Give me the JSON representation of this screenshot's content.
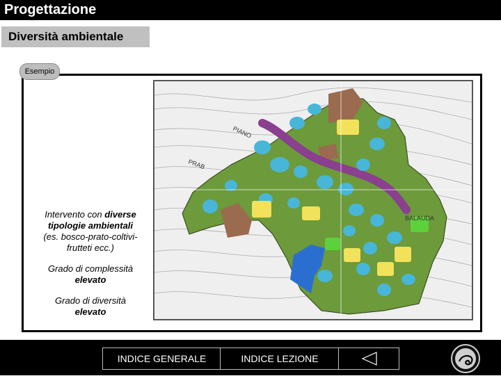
{
  "header": {
    "title": "Progettazione"
  },
  "section": {
    "subtitle": "Diversità ambientale"
  },
  "badge": {
    "label": "Esempio"
  },
  "description": {
    "p1_normal": "Intervento con ",
    "p1_bold1": "diverse",
    "p1_bold2": "tipologie ambientali",
    "p1_normal2": "(es. bosco-prato-coltivi-frutteti ecc.)",
    "p2_normal": "Grado di complessità",
    "p2_bold": "elevato",
    "p3_normal": "Grado di diversità",
    "p3_bold": "elevato"
  },
  "map": {
    "labels": [
      "PIANO",
      "PRAB",
      "BALAUDA"
    ],
    "colors": {
      "forest": "#6d9a3a",
      "meadow": "#48b6d8",
      "orchard": "#f1e15b",
      "crop": "#9a6b4f",
      "hedge": "#8a3f8f",
      "wetland": "#2a6fd0",
      "lawn": "#5dd13a"
    }
  },
  "nav": {
    "index_general": "INDICE GENERALE",
    "index_lesson": "INDICE LEZIONE",
    "back_icon": "triangle-left-icon",
    "logo_icon": "seal-logo-icon"
  }
}
